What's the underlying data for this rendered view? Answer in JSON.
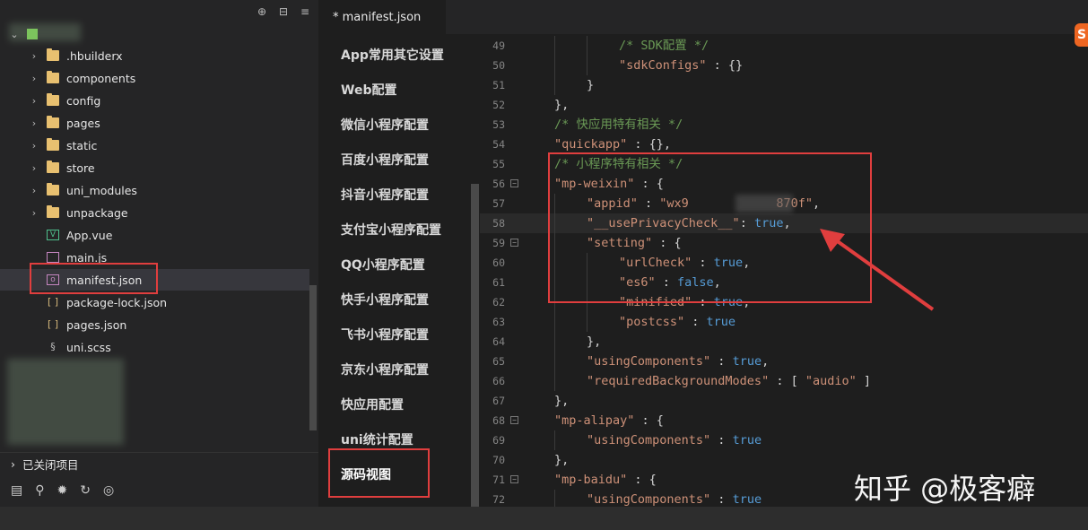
{
  "explorer": {
    "toolbar": [
      "⊕",
      "⊟",
      "≡"
    ],
    "items": [
      {
        "label": ".hbuilderx",
        "type": "folder"
      },
      {
        "label": "components",
        "type": "folder"
      },
      {
        "label": "config",
        "type": "folder"
      },
      {
        "label": "pages",
        "type": "folder"
      },
      {
        "label": "static",
        "type": "folder"
      },
      {
        "label": "store",
        "type": "folder"
      },
      {
        "label": "uni_modules",
        "type": "folder"
      },
      {
        "label": "unpackage",
        "type": "folder"
      },
      {
        "label": "App.vue",
        "type": "vue"
      },
      {
        "label": "main.js",
        "type": "js"
      },
      {
        "label": "manifest.json",
        "type": "json-selected"
      },
      {
        "label": "package-lock.json",
        "type": "json"
      },
      {
        "label": "pages.json",
        "type": "json"
      },
      {
        "label": "uni.scss",
        "type": "scss"
      }
    ],
    "closed_projects": "已关闭项目"
  },
  "tab": {
    "title": "* manifest.json"
  },
  "nav": [
    "App常用其它设置",
    "Web配置",
    "微信小程序配置",
    "百度小程序配置",
    "抖音小程序配置",
    "支付宝小程序配置",
    "QQ小程序配置",
    "快手小程序配置",
    "飞书小程序配置",
    "京东小程序配置",
    "快应用配置",
    "uni统计配置",
    "源码视图"
  ],
  "code": [
    {
      "n": "49",
      "indent": 3,
      "parts": [
        [
          "c-com",
          "/* SDK配置 */"
        ]
      ]
    },
    {
      "n": "50",
      "indent": 3,
      "parts": [
        [
          "c-str",
          "\"sdkConfigs\""
        ],
        [
          "c-pun",
          " : {}"
        ]
      ]
    },
    {
      "n": "51",
      "indent": 2,
      "parts": [
        [
          "c-pun",
          "}"
        ]
      ]
    },
    {
      "n": "52",
      "indent": 1,
      "parts": [
        [
          "c-pun",
          "},"
        ]
      ]
    },
    {
      "n": "53",
      "indent": 1,
      "parts": [
        [
          "c-com",
          "/* 快应用特有相关 */"
        ]
      ]
    },
    {
      "n": "54",
      "indent": 1,
      "parts": [
        [
          "c-str",
          "\"quickapp\""
        ],
        [
          "c-pun",
          " : {},"
        ]
      ]
    },
    {
      "n": "55",
      "indent": 1,
      "parts": [
        [
          "c-com",
          "/* 小程序特有相关 */"
        ]
      ]
    },
    {
      "n": "56",
      "indent": 1,
      "fold": true,
      "parts": [
        [
          "c-str",
          "\"mp-weixin\""
        ],
        [
          "c-pun",
          " : {"
        ]
      ]
    },
    {
      "n": "57",
      "indent": 2,
      "parts": [
        [
          "c-str",
          "\"appid\""
        ],
        [
          "c-pun",
          " : "
        ],
        [
          "c-str",
          "\"wx9            870f\""
        ],
        [
          "c-pun",
          ","
        ]
      ]
    },
    {
      "n": "58",
      "indent": 2,
      "hl": true,
      "parts": [
        [
          "c-str",
          "\"__usePrivacyCheck__\""
        ],
        [
          "c-pun",
          ": "
        ],
        [
          "c-kw",
          "true"
        ],
        [
          "c-pun",
          ","
        ]
      ]
    },
    {
      "n": "59",
      "indent": 2,
      "fold": true,
      "parts": [
        [
          "c-str",
          "\"setting\""
        ],
        [
          "c-pun",
          " : {"
        ]
      ]
    },
    {
      "n": "60",
      "indent": 3,
      "parts": [
        [
          "c-str",
          "\"urlCheck\""
        ],
        [
          "c-pun",
          " : "
        ],
        [
          "c-kw",
          "true"
        ],
        [
          "c-pun",
          ","
        ]
      ]
    },
    {
      "n": "61",
      "indent": 3,
      "parts": [
        [
          "c-str",
          "\"es6\""
        ],
        [
          "c-pun",
          " : "
        ],
        [
          "c-kw",
          "false"
        ],
        [
          "c-pun",
          ","
        ]
      ]
    },
    {
      "n": "62",
      "indent": 3,
      "parts": [
        [
          "c-str",
          "\"minified\""
        ],
        [
          "c-pun",
          " : "
        ],
        [
          "c-kw",
          "true"
        ],
        [
          "c-pun",
          ","
        ]
      ]
    },
    {
      "n": "63",
      "indent": 3,
      "parts": [
        [
          "c-str",
          "\"postcss\""
        ],
        [
          "c-pun",
          " : "
        ],
        [
          "c-kw",
          "true"
        ]
      ]
    },
    {
      "n": "64",
      "indent": 2,
      "parts": [
        [
          "c-pun",
          "},"
        ]
      ]
    },
    {
      "n": "65",
      "indent": 2,
      "parts": [
        [
          "c-str",
          "\"usingComponents\""
        ],
        [
          "c-pun",
          " : "
        ],
        [
          "c-kw",
          "true"
        ],
        [
          "c-pun",
          ","
        ]
      ]
    },
    {
      "n": "66",
      "indent": 2,
      "parts": [
        [
          "c-str",
          "\"requiredBackgroundModes\""
        ],
        [
          "c-pun",
          " : [ "
        ],
        [
          "c-str",
          "\"audio\""
        ],
        [
          "c-pun",
          " ]"
        ]
      ]
    },
    {
      "n": "67",
      "indent": 1,
      "parts": [
        [
          "c-pun",
          "},"
        ]
      ]
    },
    {
      "n": "68",
      "indent": 1,
      "fold": true,
      "parts": [
        [
          "c-str",
          "\"mp-alipay\""
        ],
        [
          "c-pun",
          " : {"
        ]
      ]
    },
    {
      "n": "69",
      "indent": 2,
      "parts": [
        [
          "c-str",
          "\"usingComponents\""
        ],
        [
          "c-pun",
          " : "
        ],
        [
          "c-kw",
          "true"
        ]
      ]
    },
    {
      "n": "70",
      "indent": 1,
      "parts": [
        [
          "c-pun",
          "},"
        ]
      ]
    },
    {
      "n": "71",
      "indent": 1,
      "fold": true,
      "parts": [
        [
          "c-str",
          "\"mp-baidu\""
        ],
        [
          "c-pun",
          " : {"
        ]
      ]
    },
    {
      "n": "72",
      "indent": 2,
      "parts": [
        [
          "c-str",
          "\"usingComponents\""
        ],
        [
          "c-pun",
          " : "
        ],
        [
          "c-kw",
          "true"
        ]
      ]
    }
  ],
  "watermark": "知乎 @极客癖",
  "colors": {
    "annotation": "#e03e3e",
    "background": "#1e1e1e"
  }
}
